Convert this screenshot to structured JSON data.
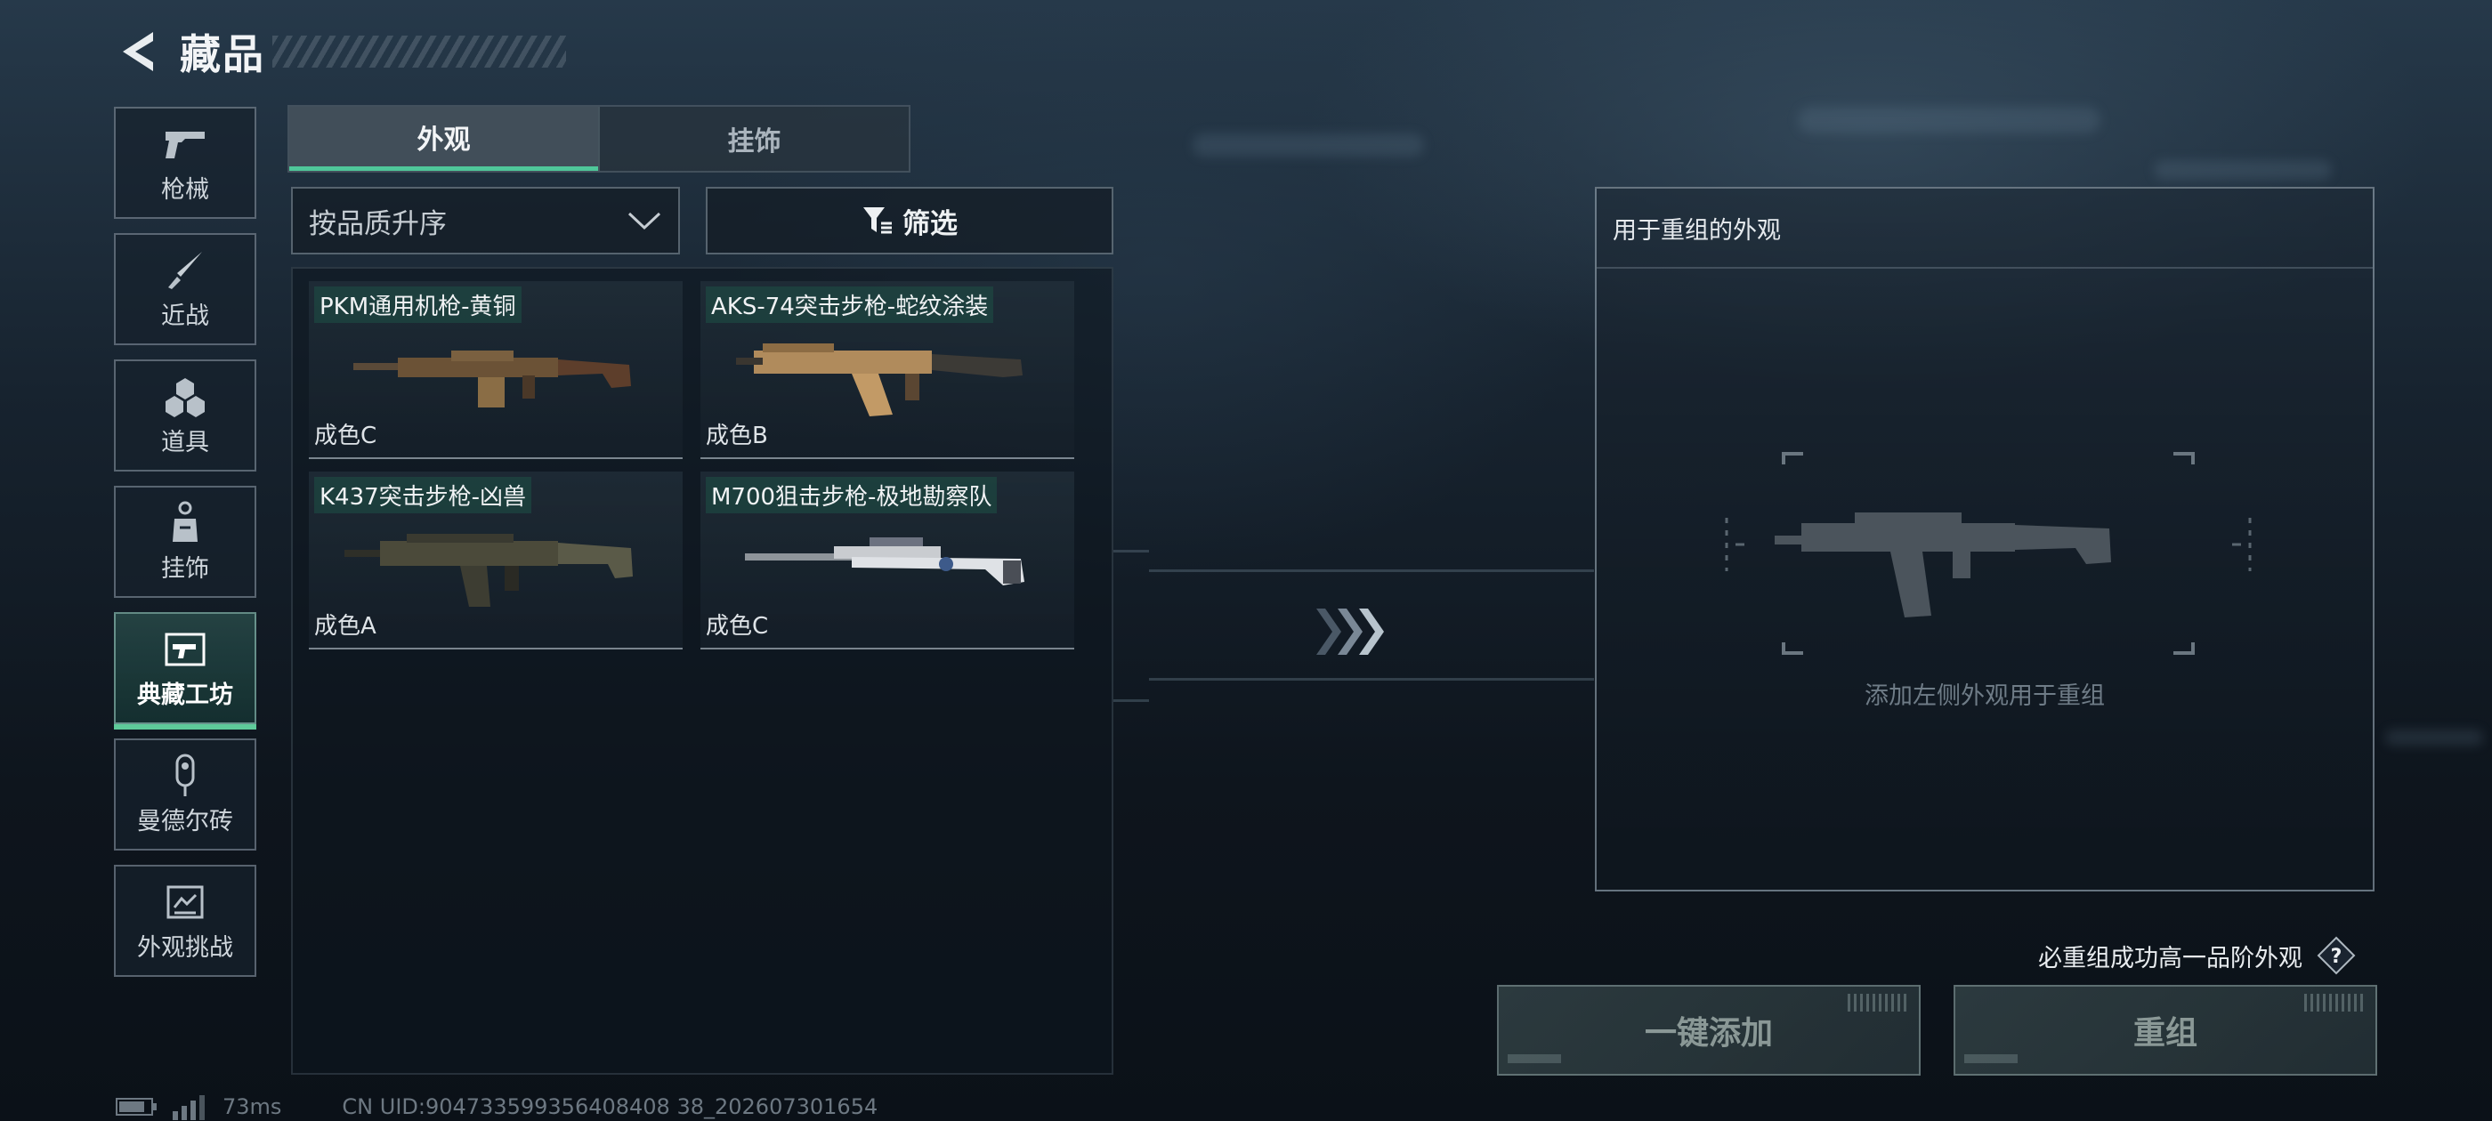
{
  "header": {
    "title": "藏品"
  },
  "sidebar": {
    "items": [
      {
        "label": "枪械",
        "icon": "pistol-icon",
        "active": false
      },
      {
        "label": "近战",
        "icon": "knife-icon",
        "active": false
      },
      {
        "label": "道具",
        "icon": "grenade-icon",
        "active": false
      },
      {
        "label": "挂饰",
        "icon": "charm-icon",
        "active": false
      },
      {
        "label": "典藏工坊",
        "icon": "workshop-icon",
        "active": true
      },
      {
        "label": "曼德尔砖",
        "icon": "brick-icon",
        "active": false
      },
      {
        "label": "外观挑战",
        "icon": "challenge-icon",
        "active": false
      }
    ]
  },
  "tabs": [
    {
      "label": "外观",
      "active": true
    },
    {
      "label": "挂饰",
      "active": false
    }
  ],
  "sort": {
    "value": "按品质升序"
  },
  "filter": {
    "label": "筛选"
  },
  "items": [
    {
      "name": "PKM通用机枪-黄铜",
      "grade": "成色C"
    },
    {
      "name": "AKS-74突击步枪-蛇纹涂装",
      "grade": "成色B"
    },
    {
      "name": "K437突击步枪-凶兽",
      "grade": "成色A"
    },
    {
      "name": "M700狙击步枪-极地勘察队",
      "grade": "成色C"
    }
  ],
  "right_panel": {
    "title": "用于重组的外观",
    "hint": "添加左侧外观用于重组"
  },
  "guarantee": {
    "text": "必重组成功高一品阶外观"
  },
  "buttons": {
    "add_all": "一键添加",
    "recombine": "重组"
  },
  "status": {
    "ping": "73ms",
    "uid": "CN UID:904733599356408408 38_202607301654"
  },
  "colors": {
    "accent": "#4fc79a",
    "active_tab": "#5ecb9a"
  }
}
